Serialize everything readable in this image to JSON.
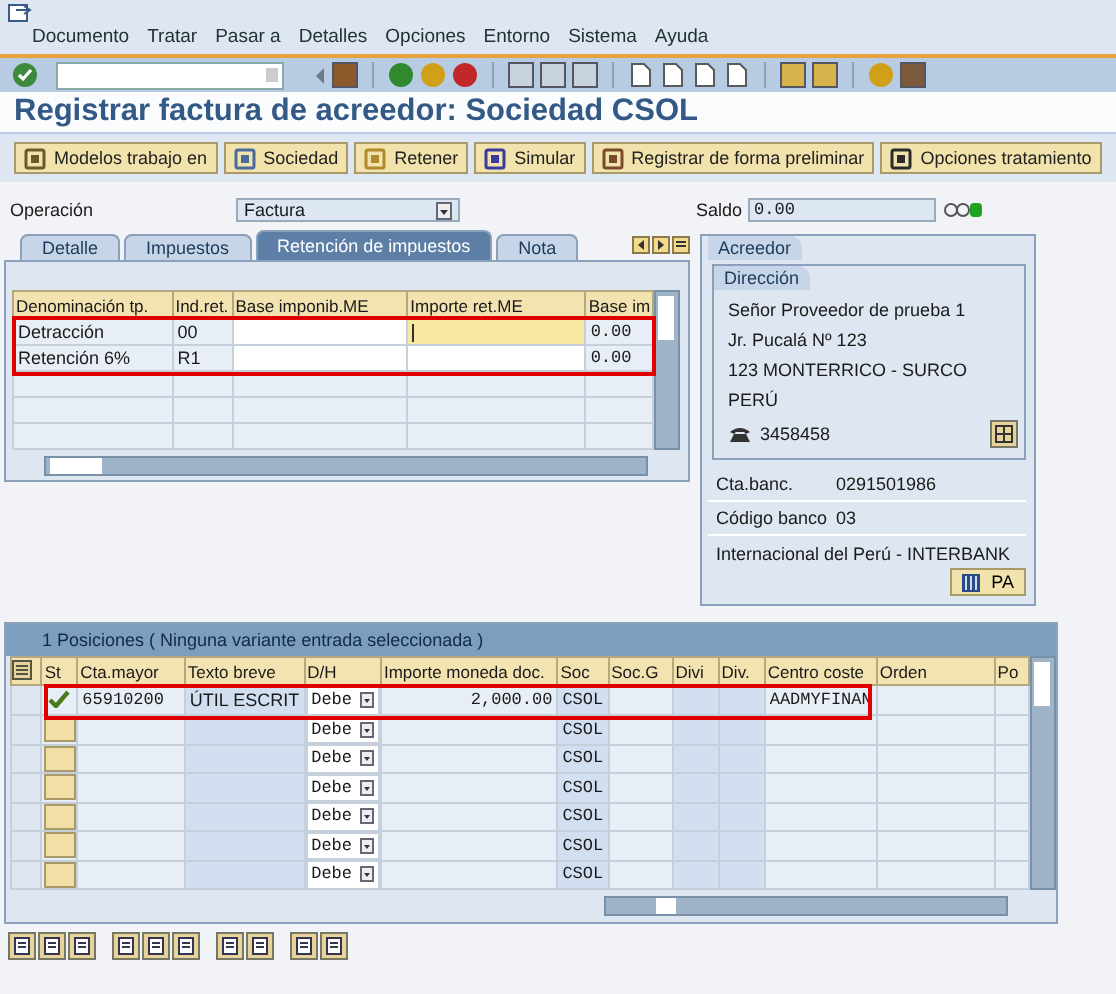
{
  "menu": [
    "Documento",
    "Tratar",
    "Pasar a",
    "Detalles",
    "Opciones",
    "Entorno",
    "Sistema",
    "Ayuda"
  ],
  "title": "Registrar factura de acreedor: Sociedad CSOL",
  "app_buttons": [
    "Modelos trabajo en",
    "Sociedad",
    "Retener",
    "Simular",
    "Registrar de forma preliminar",
    "Opciones tratamiento"
  ],
  "operation": {
    "label": "Operación",
    "value": "Factura"
  },
  "balance": {
    "label": "Saldo",
    "value": "0.00"
  },
  "tabs": [
    {
      "label": "Detalle",
      "selected": false
    },
    {
      "label": "Impuestos",
      "selected": false
    },
    {
      "label": "Retención de impuestos",
      "selected": true
    },
    {
      "label": "Nota",
      "selected": false
    }
  ],
  "withholding": {
    "columns": [
      "Denominación tp.",
      "Ind.ret.",
      "Base imponib.ME",
      "Importe ret.ME",
      "Base im"
    ],
    "rows": [
      {
        "name": "Detracción",
        "indicator": "00",
        "base_amount": "0.00",
        "focused": true
      },
      {
        "name": "Retención 6%",
        "indicator": "R1",
        "base_amount": "0.00",
        "focused": false
      }
    ]
  },
  "vendor": {
    "title": "Acreedor",
    "address_title": "Dirección",
    "address_lines": [
      "Señor Proveedor de prueba 1",
      "Jr. Pucalá Nº 123",
      "123 MONTERRICO - SURCO",
      "PERÚ"
    ],
    "phone": "3458458",
    "bank_account": {
      "label": "Cta.banc.",
      "value": "0291501986"
    },
    "bank_code": {
      "label": "Código banco",
      "value": "03"
    },
    "bank_name": "Internacional del Perú - INTERBANK",
    "button": "PA"
  },
  "positions": {
    "title": "1 Posiciones ( Ninguna variante entrada seleccionada )",
    "columns": [
      "St",
      "Cta.mayor",
      "Texto breve",
      "D/H",
      "Importe moneda doc.",
      "Soc",
      "Soc.G",
      "Divi",
      "Div.",
      "Centro coste",
      "Orden",
      "Po"
    ],
    "rows": [
      {
        "done": true,
        "account": "65910200",
        "text": "ÚTIL ESCRIT",
        "dh": "Debe",
        "amount": "2,000.00",
        "company": "CSOL",
        "cost_center": "AADMYFINAN"
      },
      {
        "done": false,
        "dh": "Debe",
        "company": "CSOL"
      },
      {
        "done": false,
        "dh": "Debe",
        "company": "CSOL"
      },
      {
        "done": false,
        "dh": "Debe",
        "company": "CSOL"
      },
      {
        "done": false,
        "dh": "Debe",
        "company": "CSOL"
      },
      {
        "done": false,
        "dh": "Debe",
        "company": "CSOL"
      },
      {
        "done": false,
        "dh": "Debe",
        "company": "CSOL"
      }
    ]
  }
}
